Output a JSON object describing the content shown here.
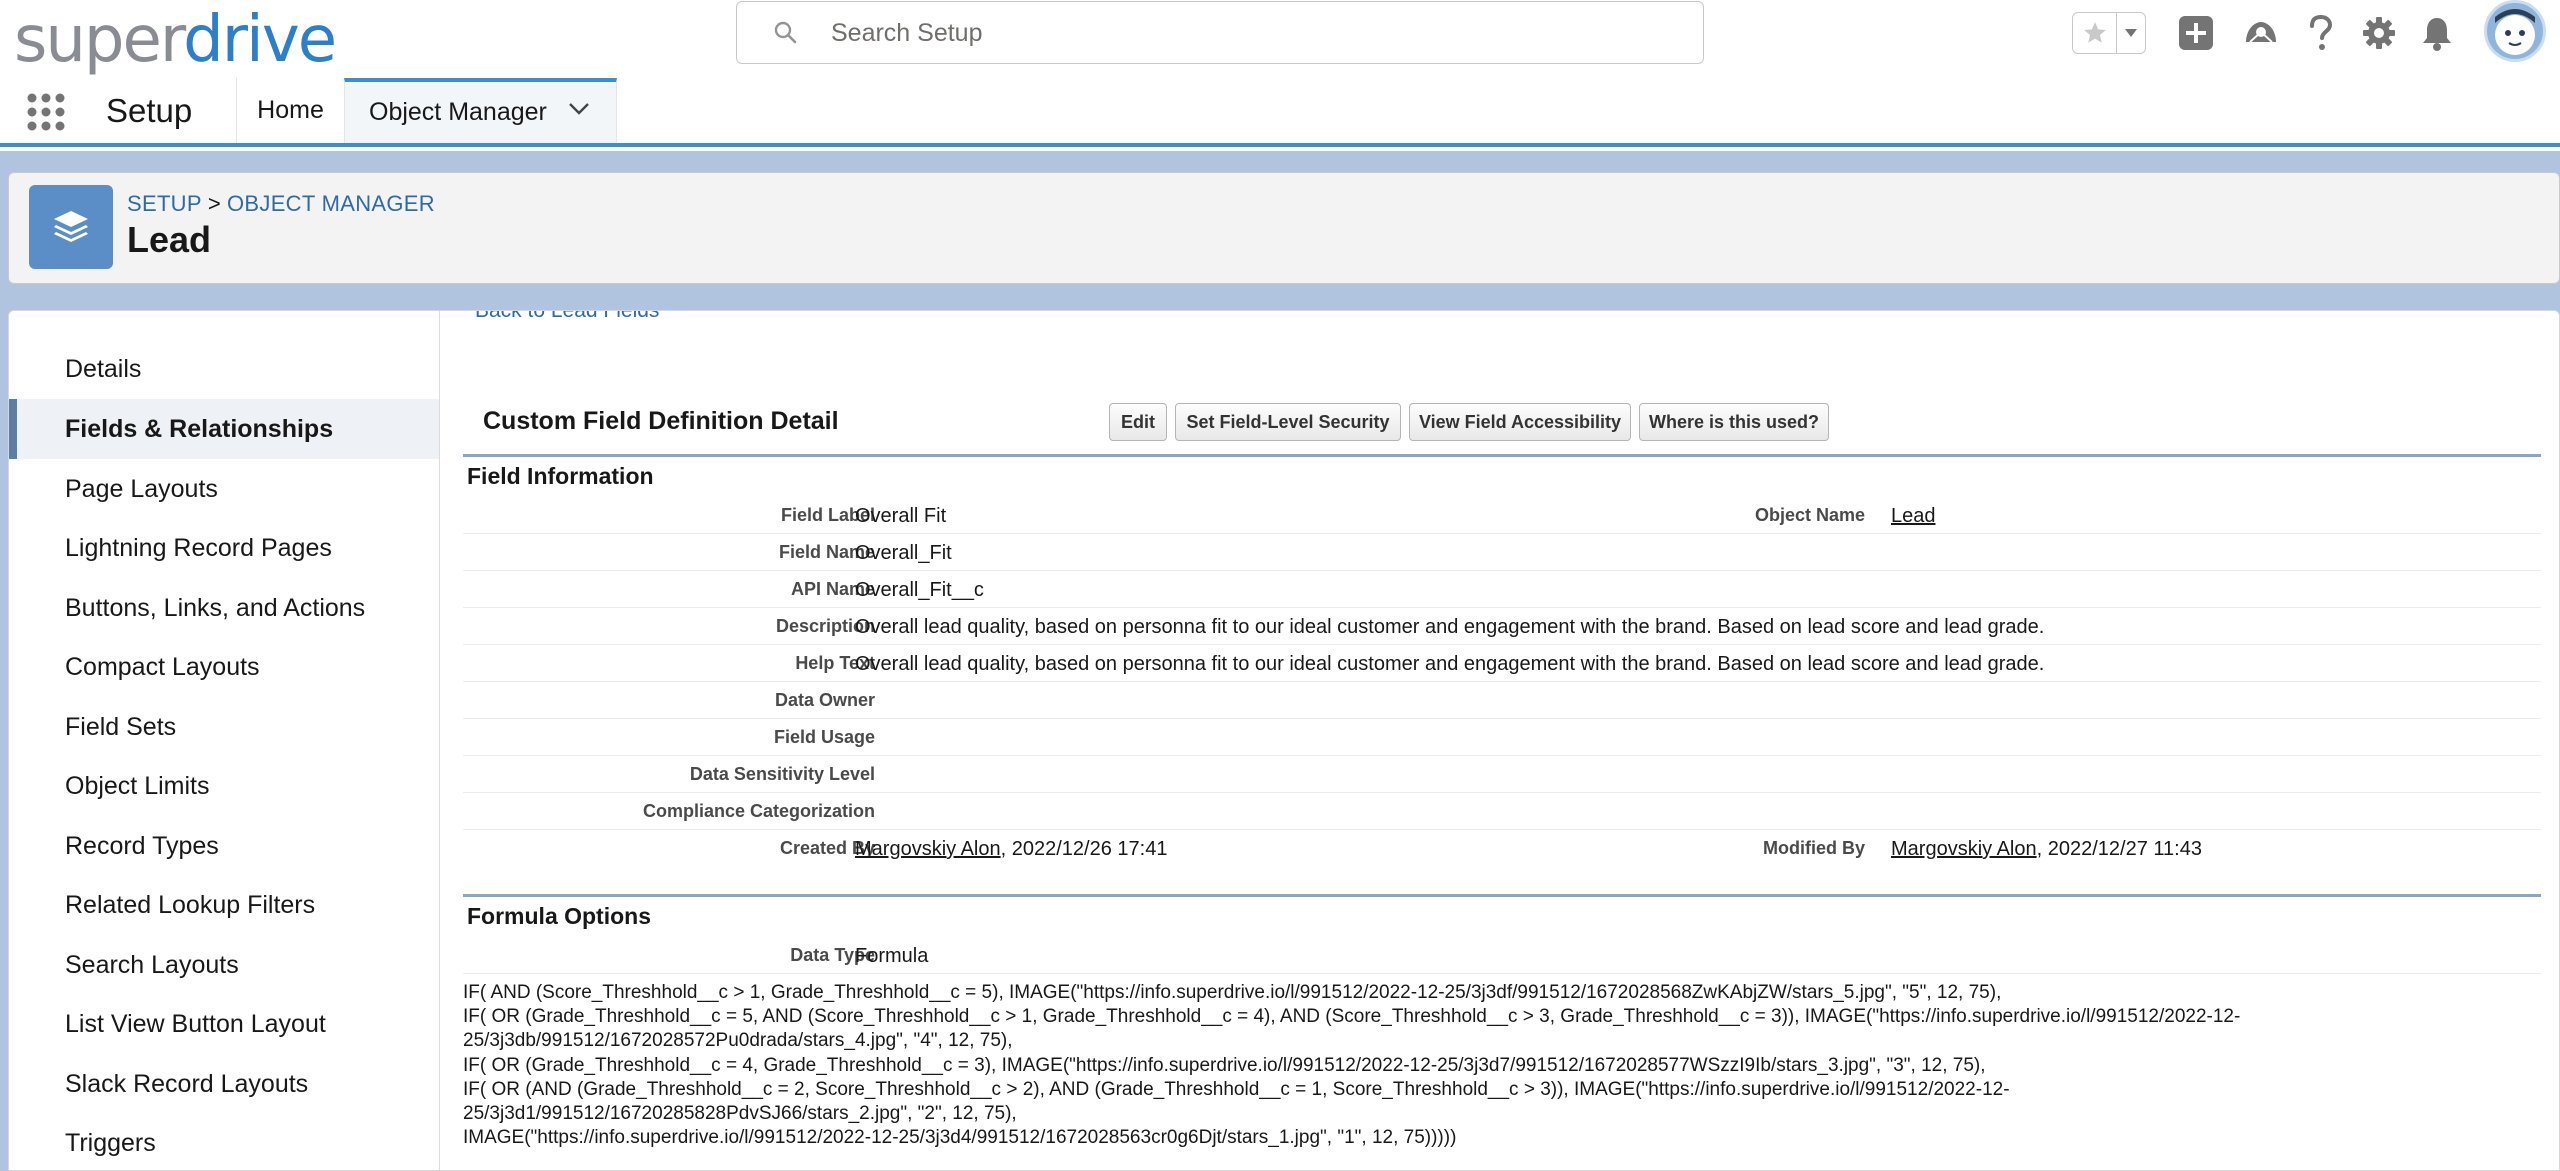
{
  "brand": {
    "logo_part1": "super",
    "logo_part2": "drive",
    "accent": "#2e7fc9",
    "logo_grey": "#8a8c93"
  },
  "search": {
    "placeholder": "Search Setup"
  },
  "header_icons": [
    "favorite-star-icon",
    "add-icon",
    "trailhead-icon",
    "help-icon",
    "settings-gear-icon",
    "notification-bell-icon",
    "avatar"
  ],
  "nav": {
    "app_name": "Setup",
    "tabs": [
      {
        "label": "Home"
      },
      {
        "label": "Object Manager",
        "active": true
      }
    ]
  },
  "page_header": {
    "breadcrumb": [
      "SETUP",
      "OBJECT MANAGER"
    ],
    "breadcrumb_sep": ">",
    "title": "Lead"
  },
  "sidebar": {
    "items": [
      {
        "label": "Details"
      },
      {
        "label": "Fields & Relationships",
        "active": true
      },
      {
        "label": "Page Layouts"
      },
      {
        "label": "Lightning Record Pages"
      },
      {
        "label": "Buttons, Links, and Actions"
      },
      {
        "label": "Compact Layouts"
      },
      {
        "label": "Field Sets"
      },
      {
        "label": "Object Limits"
      },
      {
        "label": "Record Types"
      },
      {
        "label": "Related Lookup Filters"
      },
      {
        "label": "Search Layouts"
      },
      {
        "label": "List View Button Layout"
      },
      {
        "label": "Slack Record Layouts"
      },
      {
        "label": "Triggers"
      }
    ]
  },
  "detail": {
    "back_link": "Back to Lead Fields",
    "title": "Custom Field Definition Detail",
    "buttons": {
      "edit": "Edit",
      "fls": "Set Field-Level Security",
      "accessibility": "View Field Accessibility",
      "where_used": "Where is this used?"
    },
    "field_info": {
      "section_title": "Field Information",
      "field_label": {
        "label": "Field Label",
        "value": "Overall Fit"
      },
      "object_name": {
        "label": "Object Name",
        "value": "Lead"
      },
      "field_name": {
        "label": "Field Name",
        "value": "Overall_Fit"
      },
      "api_name": {
        "label": "API Name",
        "value": "Overall_Fit__c"
      },
      "description": {
        "label": "Description",
        "value": "Overall lead quality, based on personna fit to our ideal customer and engagement with the brand. Based on lead score and lead grade."
      },
      "help_text": {
        "label": "Help Text",
        "value": "Overall lead quality, based on personna fit to our ideal customer and engagement with the brand. Based on lead score and lead grade."
      },
      "data_owner": {
        "label": "Data Owner",
        "value": ""
      },
      "field_usage": {
        "label": "Field Usage",
        "value": ""
      },
      "sensitivity": {
        "label": "Data Sensitivity Level",
        "value": ""
      },
      "compliance": {
        "label": "Compliance Categorization",
        "value": ""
      },
      "created_by": {
        "label": "Created By",
        "user": "Margovskiy Alon",
        "date": ", 2022/12/26 17:41"
      },
      "modified_by": {
        "label": "Modified By",
        "user": "Margovskiy Alon",
        "date": ", 2022/12/27 11:43"
      }
    },
    "formula_options": {
      "section_title": "Formula Options",
      "data_type": {
        "label": "Data Type",
        "value": "Formula"
      },
      "formula_lines": [
        "IF( AND (Score_Threshhold__c > 1, Grade_Threshhold__c = 5), IMAGE(\"https://info.superdrive.io/l/991512/2022-12-25/3j3df/991512/1672028568ZwKAbjZW/stars_5.jpg\", \"5\", 12, 75),",
        "IF( OR (Grade_Threshhold__c = 5, AND (Score_Threshhold__c > 1, Grade_Threshhold__c = 4), AND (Score_Threshhold__c > 3, Grade_Threshhold__c = 3)), IMAGE(\"https://info.superdrive.io/l/991512/2022-12-",
        "25/3j3db/991512/1672028572Pu0drada/stars_4.jpg\", \"4\", 12, 75),",
        "IF( OR (Grade_Threshhold__c = 4, Grade_Threshhold__c = 3), IMAGE(\"https://info.superdrive.io/l/991512/2022-12-25/3j3d7/991512/1672028577WSzzI9Ib/stars_3.jpg\", \"3\", 12, 75),",
        "IF( OR (AND (Grade_Threshhold__c = 2, Score_Threshhold__c > 2), AND (Grade_Threshhold__c = 1, Score_Threshhold__c > 3)), IMAGE(\"https://info.superdrive.io/l/991512/2022-12-",
        "25/3j3d1/991512/16720285828PdvSJ66/stars_2.jpg\", \"2\", 12, 75),",
        "IMAGE(\"https://info.superdrive.io/l/991512/2022-12-25/3j3d4/991512/1672028563cr0g6Djt/stars_1.jpg\", \"1\", 12, 75)))))"
      ]
    }
  }
}
